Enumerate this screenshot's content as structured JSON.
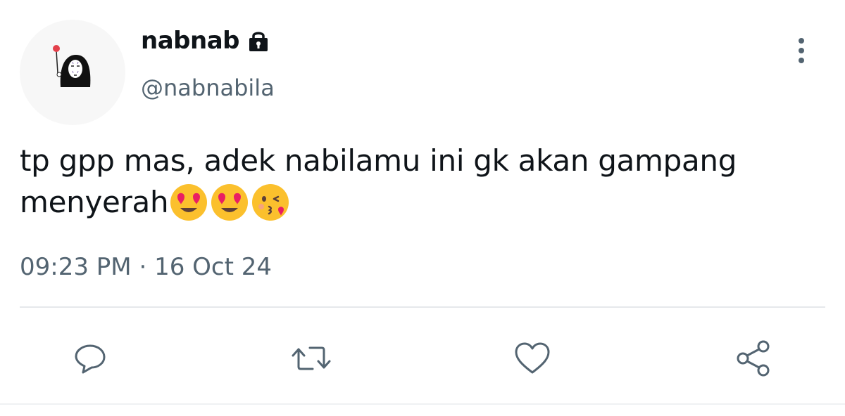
{
  "user": {
    "display_name": "nabnab",
    "handle": "@nabnabila",
    "avatar_icon": "noface-avatar",
    "protected_icon": "lock-icon"
  },
  "tweet": {
    "text": "tp gpp mas, adek nabilamu ini gk akan gampang menyerah",
    "emojis": [
      "heart-eyes-emoji",
      "heart-eyes-emoji",
      "kissing-wink-heart-emoji"
    ],
    "time": "09:23 PM",
    "separator": "·",
    "date": "16 Oct 24"
  },
  "actions": [
    "reply-icon",
    "retweet-icon",
    "like-icon",
    "share-icon"
  ],
  "colors": {
    "text": "#0f1419",
    "secondary": "#536471",
    "divider": "#e6e8eb"
  }
}
